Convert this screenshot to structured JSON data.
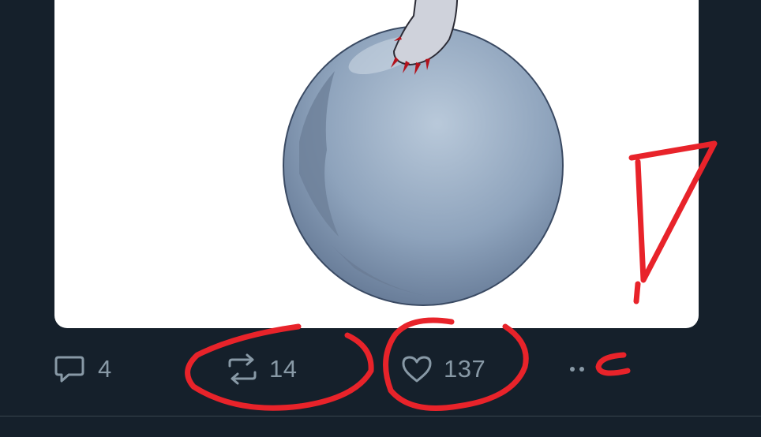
{
  "tweet": {
    "actions": {
      "reply_count": "4",
      "retweet_count": "14",
      "like_count": "137"
    },
    "icons": {
      "reply": "speech-bubble-icon",
      "retweet": "retweet-arrows-icon",
      "like": "heart-icon",
      "more": "ellipsis-icon"
    }
  },
  "colors": {
    "background": "#15202b",
    "icon_gray": "#8899a6",
    "annotation_red": "#e8232a",
    "card": "#ffffff"
  }
}
